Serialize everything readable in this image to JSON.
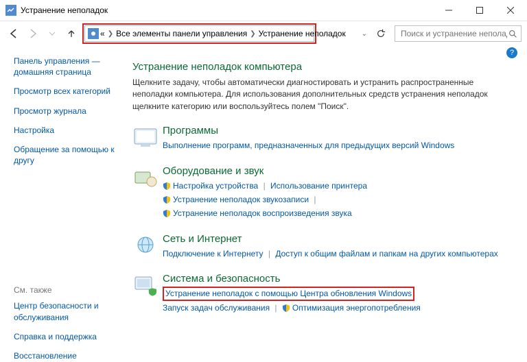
{
  "window": {
    "title": "Устранение неполадок"
  },
  "breadcrumb": {
    "prefix": "«",
    "item1": "Все элементы панели управления",
    "item2": "Устранение неполадок"
  },
  "search": {
    "placeholder": "Поиск и устранение неполад"
  },
  "sidebar": {
    "main": [
      "Панель управления — домашняя страница",
      "Просмотр всех категорий",
      "Просмотр журнала",
      "Настройка",
      "Обращение за помощью к другу"
    ],
    "also_label": "См. также",
    "also": [
      "Центр безопасности и обслуживания",
      "Справка и поддержка",
      "Восстановление"
    ]
  },
  "main": {
    "heading": "Устранение неполадок компьютера",
    "description": "Щелкните задачу, чтобы автоматически диагностировать и устранить распространенные неполадки компьютера. Для использования дополнительных средств устранения неполадок щелкните категорию или воспользуйтесь полем \"Поиск\".",
    "cats": {
      "programs": {
        "title": "Программы",
        "link1": "Выполнение программ, предназначенных для предыдущих версий Windows"
      },
      "hardware": {
        "title": "Оборудование и звук",
        "link1": "Настройка устройства",
        "link2": "Использование принтера",
        "link3": "Устранение неполадок звукозаписи",
        "link4": "Устранение неполадок воспроизведения звука"
      },
      "network": {
        "title": "Сеть и Интернет",
        "link1": "Подключение к Интернету",
        "link2": "Доступ к общим файлам и папкам на других компьютерах"
      },
      "system": {
        "title": "Система и безопасность",
        "link1": "Устранение неполадок с помощью Центра обновления Windows",
        "link2": "Запуск задач обслуживания",
        "link3": "Оптимизация энергопотребления"
      }
    }
  }
}
